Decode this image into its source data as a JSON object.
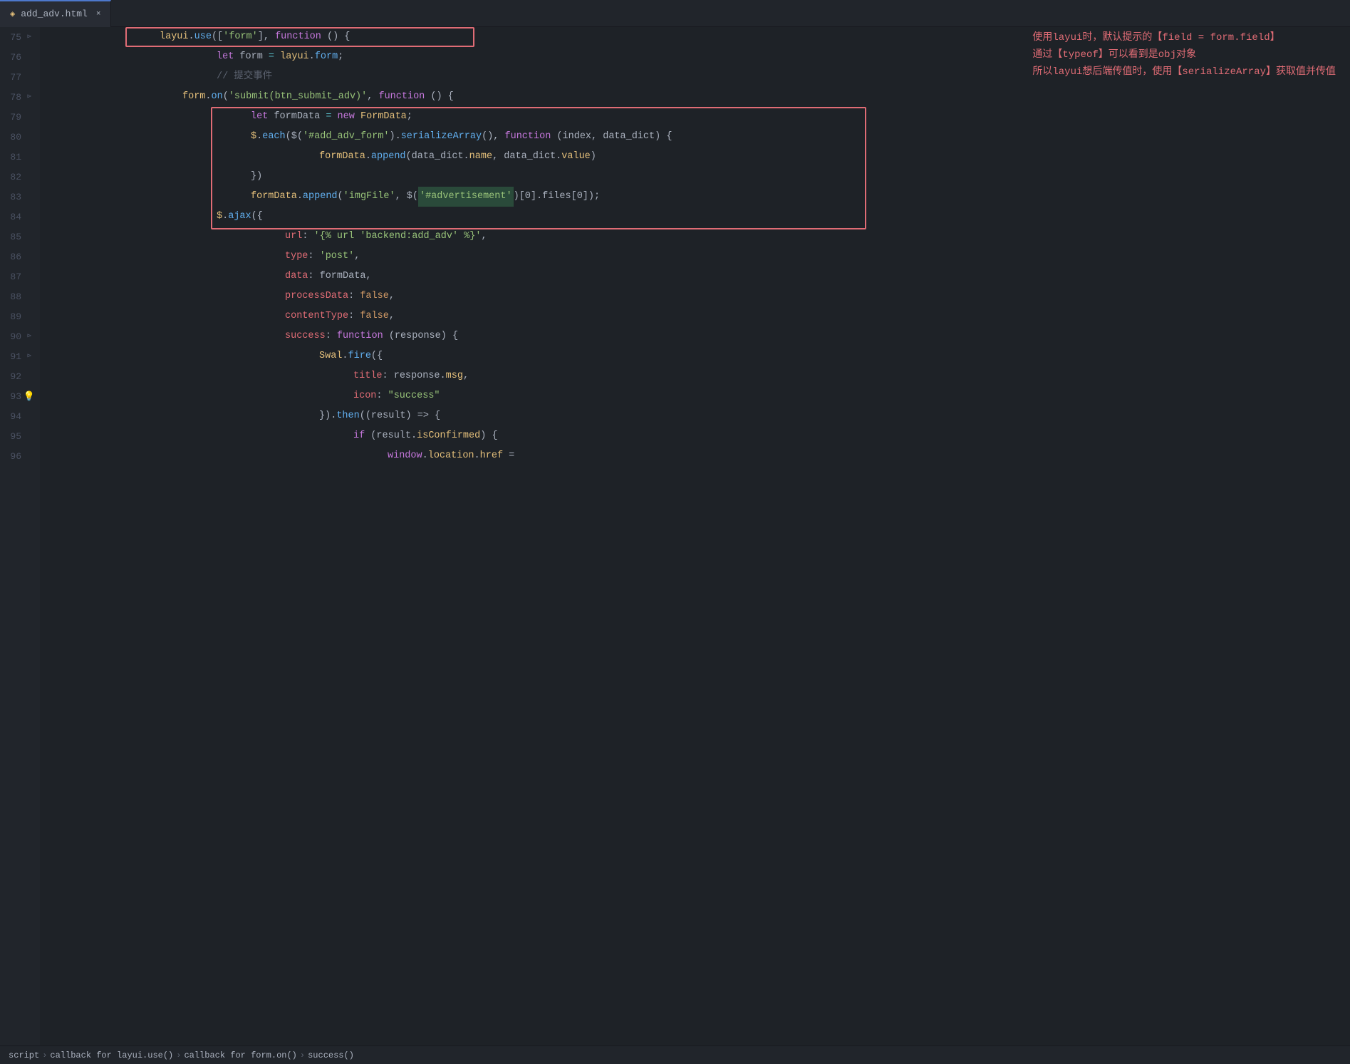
{
  "tab": {
    "filename": "add_adv.html",
    "icon": "◈",
    "close": "×"
  },
  "comments": [
    "使用layui时，默认提示的【field = form.field】",
    "通过【typeof】可以看到是obj对象",
    "所以layui想后端传值时，使用【serializeArray】获取值并传值"
  ],
  "lines": [
    {
      "num": "75",
      "fold": "⊲",
      "content": "layui_use_line"
    },
    {
      "num": "76",
      "fold": "",
      "content": "let_form_line"
    },
    {
      "num": "77",
      "fold": "",
      "content": "comment_submit"
    },
    {
      "num": "78",
      "fold": "⊲",
      "content": "form_on_line"
    },
    {
      "num": "79",
      "fold": "",
      "content": "let_formdata_line"
    },
    {
      "num": "80",
      "fold": "",
      "content": "each_serialize_line"
    },
    {
      "num": "81",
      "fold": "",
      "content": "formdata_append1_line"
    },
    {
      "num": "82",
      "fold": "",
      "content": "close_each_line"
    },
    {
      "num": "83",
      "fold": "",
      "content": "formdata_append2_line"
    },
    {
      "num": "84",
      "fold": "",
      "content": "ajax_open_line"
    },
    {
      "num": "85",
      "fold": "",
      "content": "url_line"
    },
    {
      "num": "86",
      "fold": "",
      "content": "type_line"
    },
    {
      "num": "87",
      "fold": "",
      "content": "data_line"
    },
    {
      "num": "88",
      "fold": "",
      "content": "processdata_line"
    },
    {
      "num": "89",
      "fold": "",
      "content": "contenttype_line"
    },
    {
      "num": "90",
      "fold": "⊲",
      "content": "success_line"
    },
    {
      "num": "91",
      "fold": "⊲",
      "content": "swal_fire_line"
    },
    {
      "num": "92",
      "fold": "",
      "content": "title_line"
    },
    {
      "num": "93",
      "fold": "",
      "content": "icon_line",
      "bulb": true
    },
    {
      "num": "94",
      "fold": "",
      "content": "then_line"
    },
    {
      "num": "95",
      "fold": "",
      "content": "if_line"
    },
    {
      "num": "96",
      "fold": "",
      "content": "window_line"
    }
  ],
  "statusbar": {
    "items": [
      "script",
      "callback for layui.use()",
      "callback for form.on()",
      "success()"
    ]
  }
}
